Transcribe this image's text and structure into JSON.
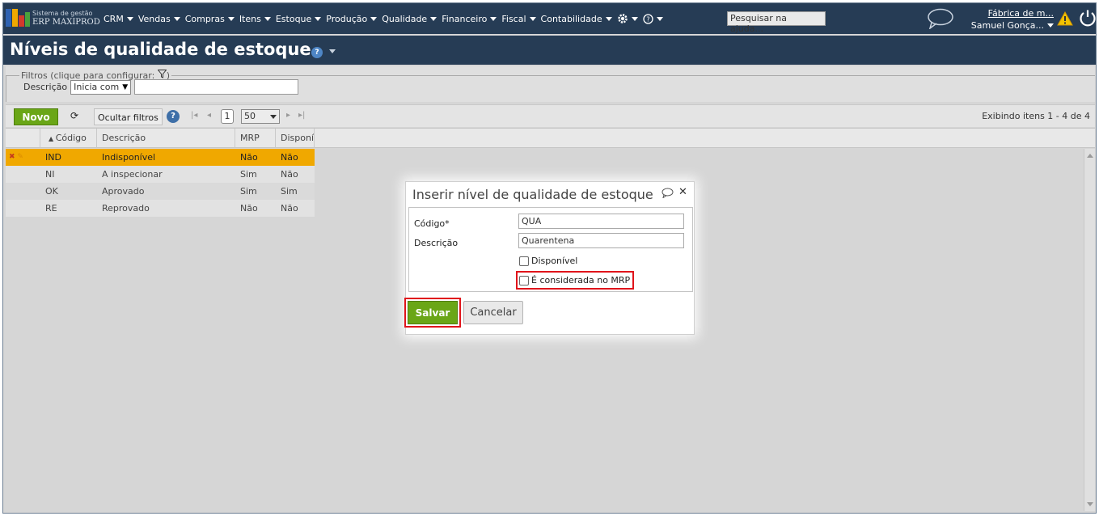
{
  "topbar": {
    "brand_line1": "Sistema de gestão",
    "brand_line2": "ERP MAXIPROD",
    "menu": [
      "CRM",
      "Vendas",
      "Compras",
      "Itens",
      "Estoque",
      "Produção",
      "Qualidade",
      "Financeiro",
      "Fiscal",
      "Contabilidade"
    ],
    "help_search_placeholder": "Pesquisar na ajuda...",
    "company": "Fábrica de m...",
    "user": "Samuel Gonça..."
  },
  "page": {
    "title": "Níveis de qualidade de estoque"
  },
  "filters": {
    "legend": "Filtros (clique para configurar: ",
    "legend_end": ")",
    "field_label": "Descrição",
    "operator": "Inicia com",
    "value": ""
  },
  "toolbar": {
    "new_label": "Novo",
    "hide_filters_label": "Ocultar filtros",
    "page": "1",
    "page_size": "50",
    "showing": "Exibindo itens 1 - 4 de 4"
  },
  "grid": {
    "columns": [
      "Código",
      "Descrição",
      "MRP",
      "Disponív"
    ],
    "rows": [
      {
        "codigo": "IND",
        "descricao": "Indisponível",
        "mrp": "Não",
        "disponivel": "Não"
      },
      {
        "codigo": "NI",
        "descricao": "A inspecionar",
        "mrp": "Sim",
        "disponivel": "Não"
      },
      {
        "codigo": "OK",
        "descricao": "Aprovado",
        "mrp": "Sim",
        "disponivel": "Sim"
      },
      {
        "codigo": "RE",
        "descricao": "Reprovado",
        "mrp": "Não",
        "disponivel": "Não"
      }
    ]
  },
  "dialog": {
    "title": "Inserir nível de qualidade de estoque",
    "codigo_label": "Código*",
    "codigo_value": "QUA",
    "descricao_label": "Descrição",
    "descricao_value": "Quarentena",
    "disponivel_label": "Disponível",
    "mrp_label": "É considerada no MRP",
    "save_label": "Salvar",
    "cancel_label": "Cancelar"
  },
  "colors": {
    "header_bg": "#263c55",
    "accent_green": "#6aa617",
    "selected_row": "#f0a800",
    "highlight_red": "#e0141b"
  }
}
